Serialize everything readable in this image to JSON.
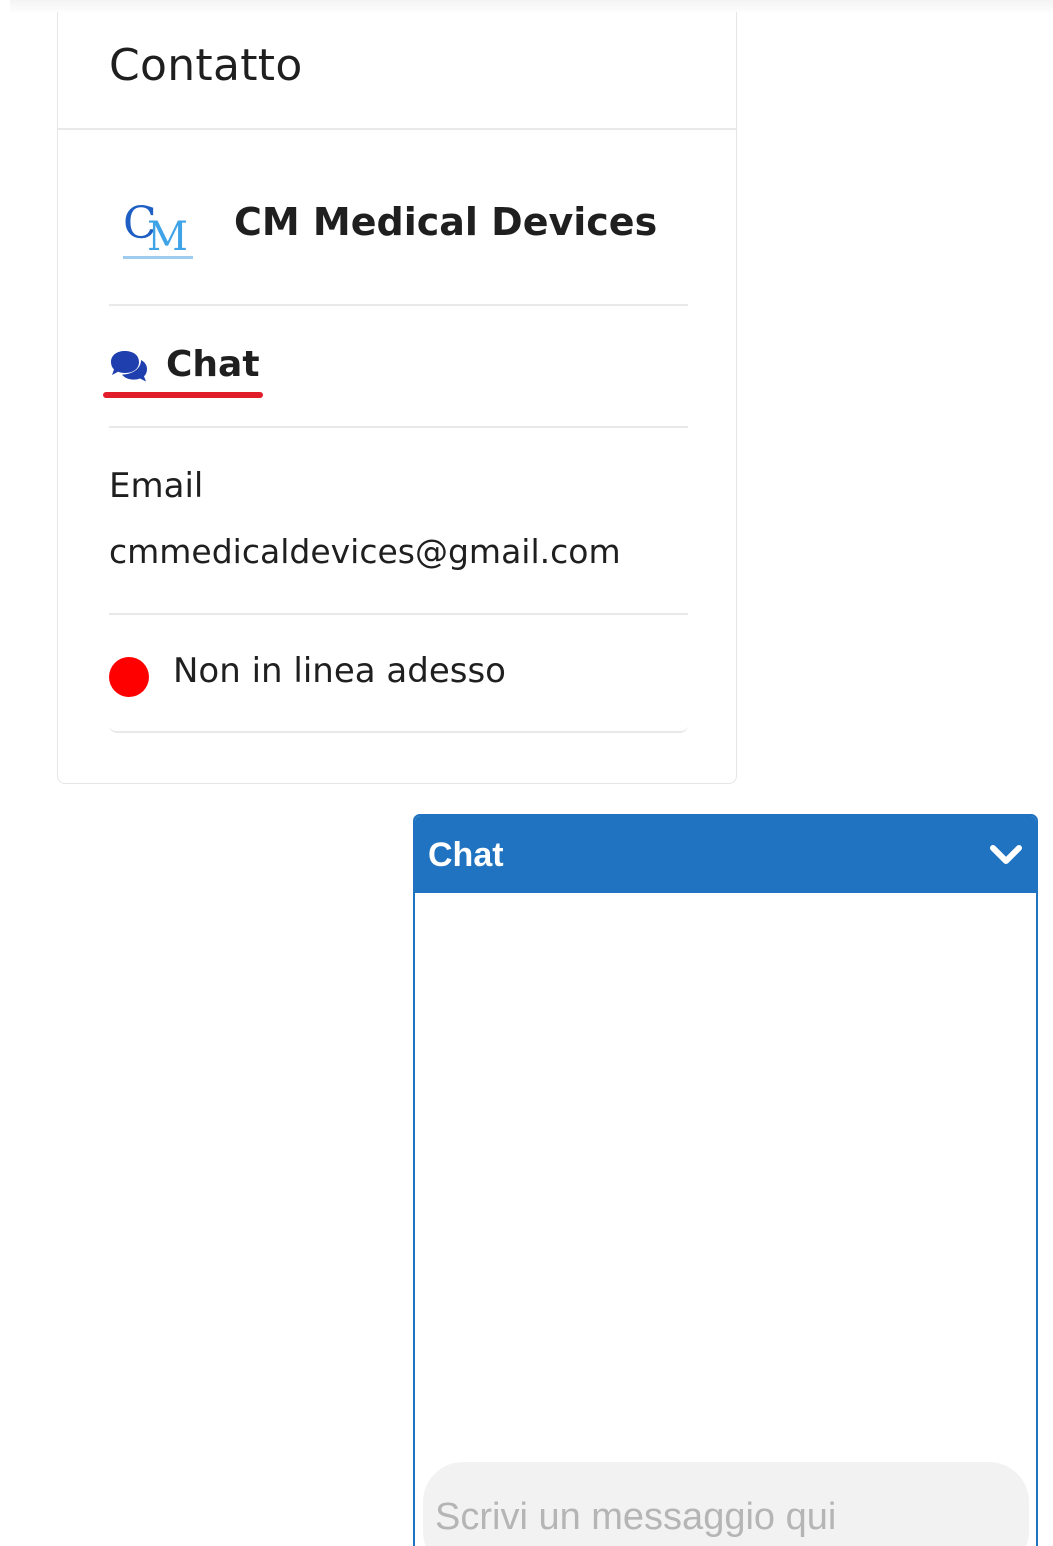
{
  "contact_card": {
    "title": "Contatto",
    "company": {
      "name": "CM Medical Devices",
      "logo_icon": "cm-medical-devices-logo",
      "logo_text": "CM",
      "logo_subtext": "MEDICAL DEVICES"
    },
    "chat": {
      "icon": "chat-bubbles-icon",
      "label": "Chat",
      "underline_color": "#e11d2a",
      "icon_color": "#1f3fae"
    },
    "email": {
      "label": "Email",
      "value": "cmmedicaldevices@gmail.com"
    },
    "status": {
      "text": "Non in linea adesso",
      "dot_color": "#ff0000"
    }
  },
  "chat_widget": {
    "title": "Chat",
    "collapse_icon": "chevron-down-icon",
    "header_color": "#1f73c0",
    "input": {
      "placeholder": "Scrivi un messaggio qui",
      "value": ""
    }
  }
}
